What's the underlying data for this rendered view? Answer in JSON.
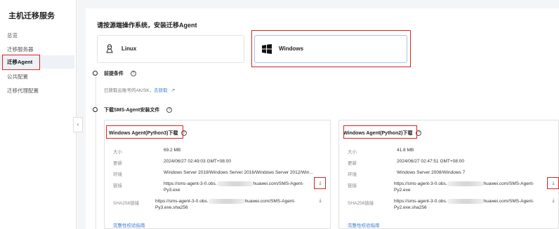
{
  "sidebar": {
    "title": "主机迁移服务",
    "items": [
      {
        "label": "总览"
      },
      {
        "label": "迁移服务器"
      },
      {
        "label": "迁移Agent"
      },
      {
        "label": "公共配置"
      },
      {
        "label": "迁移代理配置"
      }
    ],
    "collapse_glyph": "‹"
  },
  "main": {
    "heading": "请按源端操作系统，安装迁移Agent",
    "os_options": [
      {
        "label": "Linux",
        "icon": "linux-icon"
      },
      {
        "label": "Windows",
        "icon": "windows-icon",
        "selected": true
      }
    ],
    "prereq": {
      "label": "前提条件",
      "text": "已获取云账号的AK/SK，",
      "link": "去获取"
    },
    "download": {
      "label": "下载SMS-Agent安装文件"
    },
    "packages": [
      {
        "title": "Windows Agent(Python3)下载",
        "size_key": "大小",
        "size": "69.2 MB",
        "updated_key": "更新",
        "updated": "2024/06/27 02:49:03 GMT+08:00",
        "env_key": "环境",
        "env": "Windows Server 2019/Windows Server 2016/Windows Server 2012/Win...",
        "link_key": "链接",
        "link_prefix": "https://sms-agent-3-0.obs.",
        "link_suffix": "huawei.com/SMS-Agent-",
        "link_tail": "Py3.exe",
        "sha_key": "SHA256链接",
        "sha_prefix": "https://sms-agent-3-0.obs.",
        "sha_suffix": "huawei.com/SMS-Agent-",
        "sha_tail": "Py3.exe.sha256",
        "integrity": "完整性校验指南"
      },
      {
        "title": "Windows Agent(Python2)下载",
        "size_key": "大小",
        "size": "41.8 MB",
        "updated_key": "更新",
        "updated": "2024/06/27 02:47:51 GMT+08:00",
        "env_key": "环境",
        "env": "Windows Server 2008/Windows 7",
        "link_key": "链接",
        "link_prefix": "https://sms-agent-3-0.obs.",
        "link_suffix": "huawei.com/SMS-Agent-",
        "link_tail": "Py2.exe",
        "sha_key": "SHA256链接",
        "sha_prefix": "https://sms-agent-3-0.obs.",
        "sha_suffix": "huawei.com/SMS-Agent-",
        "sha_tail": "Py2.exe.sha256",
        "integrity": "完整性校验指南"
      }
    ],
    "highlight_color": "#e02020",
    "link_color": "#3c7bd6"
  }
}
